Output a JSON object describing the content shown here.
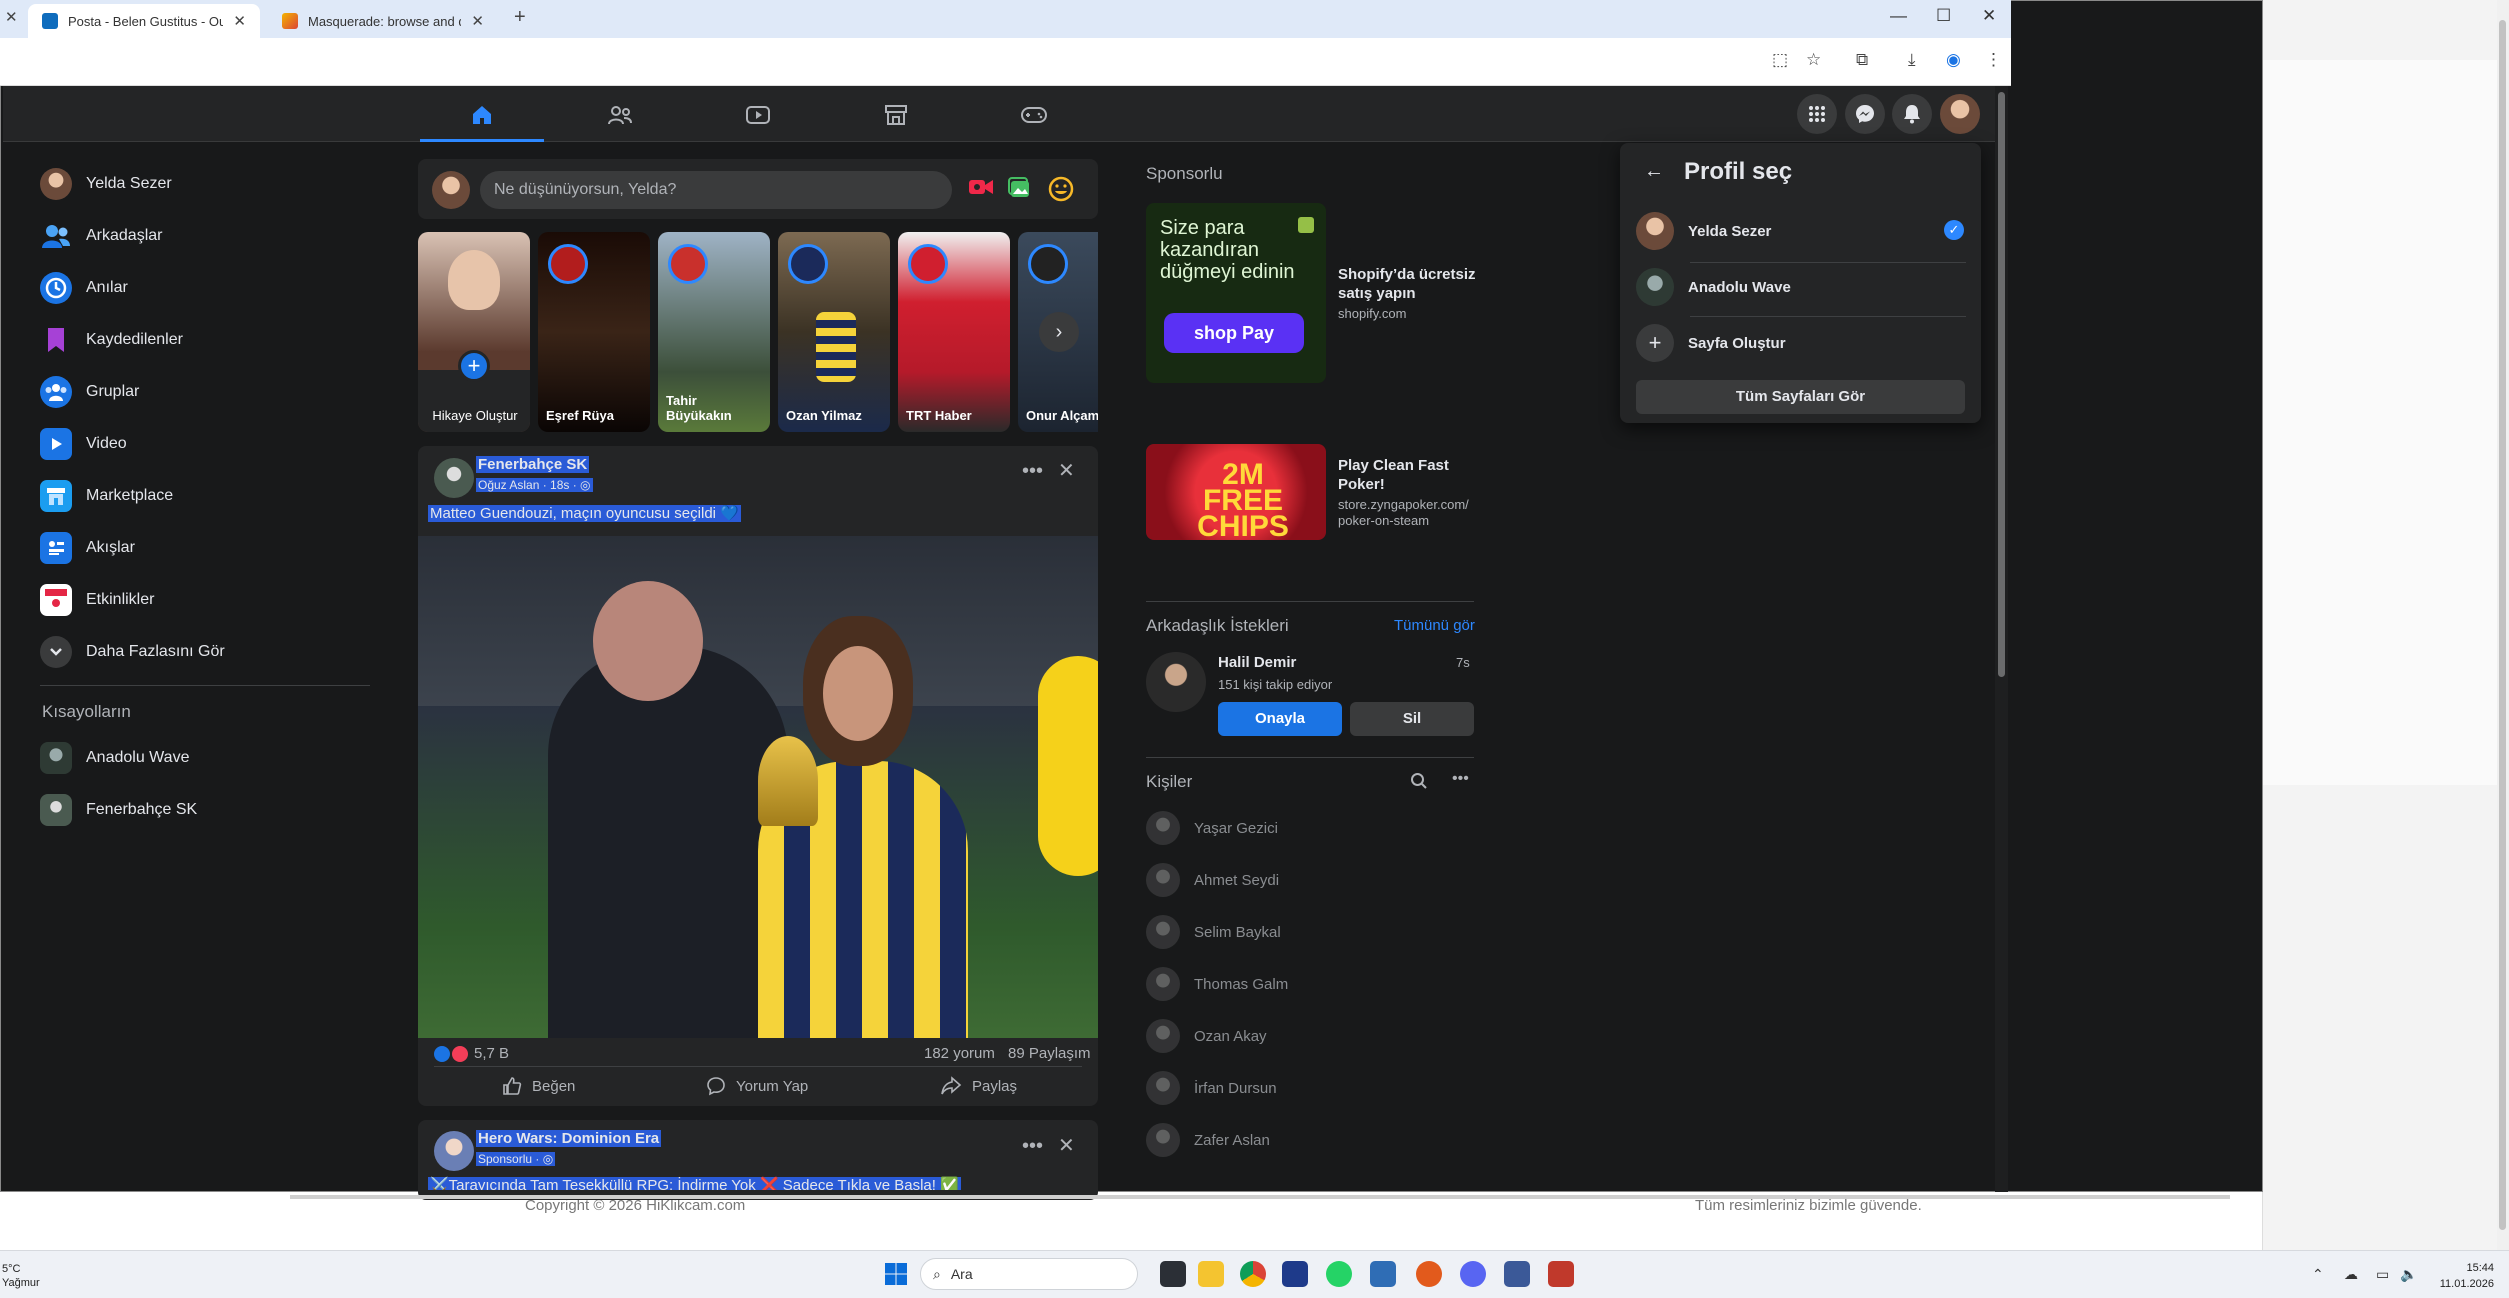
{
  "browser": {
    "tabs": [
      {
        "label": "Posta - Belen Gustitus - Outlook"
      },
      {
        "label": "Masquerade: browse and down"
      }
    ]
  },
  "nav": {
    "items": [
      "home",
      "friends",
      "video",
      "marketplace",
      "gaming"
    ]
  },
  "sidebar": {
    "items": [
      {
        "label": "Yelda Sezer"
      },
      {
        "label": "Arkadaşlar"
      },
      {
        "label": "Anılar"
      },
      {
        "label": "Kaydedilenler"
      },
      {
        "label": "Gruplar"
      },
      {
        "label": "Video"
      },
      {
        "label": "Marketplace"
      },
      {
        "label": "Akışlar"
      },
      {
        "label": "Etkinlikler"
      },
      {
        "label": "Daha Fazlasını Gör"
      }
    ],
    "shortcuts_title": "Kısayolların",
    "shortcuts": [
      {
        "label": "Anadolu Wave"
      },
      {
        "label": "Fenerbahçe SK"
      }
    ]
  },
  "composer": {
    "placeholder": "Ne düşünüyorsun, Yelda?"
  },
  "stories": [
    {
      "name": "Hikaye Oluştur"
    },
    {
      "name": "Eşref Rüya"
    },
    {
      "name": "Tahir Büyükakın"
    },
    {
      "name": "Ozan Yilmaz"
    },
    {
      "name": "TRT Haber"
    },
    {
      "name": "Onur Alçam"
    }
  ],
  "post1": {
    "page": "Fenerbahçe SK",
    "meta": "Oğuz Aslan · 18s · ◎",
    "text": "Matteo Guendouzi, maçın oyuncusu seçildi 💙",
    "reactions": "5,7 B",
    "comments": "182 yorum",
    "shares": "89 Paylaşım",
    "actions": {
      "like": "Beğen",
      "comment": "Yorum Yap",
      "share": "Paylaş"
    }
  },
  "post2": {
    "page": "Hero Wars: Dominion Era",
    "meta": "Sponsorlu · ◎",
    "text": "⚔️Tarayıcında Tam Teşekküllü RPG: İndirme Yok ❌ Sadece Tıkla ve Başla! ✅"
  },
  "right": {
    "sponsored_title": "Sponsorlu",
    "ads": [
      {
        "title": "Shopify’da ücretsiz satış yapın",
        "url": "shopify.com",
        "img_text": "Size para kazandıran düğmeyi edinin",
        "btn": "shop Pay"
      },
      {
        "title": "Play Clean Fast Poker!",
        "url": "store.zyngapoker.com/ poker-on-steam",
        "img_text": "2M FREE CHIPS"
      }
    ],
    "friend_requests": {
      "title": "Arkadaşlık İstekleri",
      "see_all": "Tümünü gör",
      "name": "Halil Demir",
      "time": "7s",
      "sub": "151 kişi takip ediyor",
      "confirm": "Onayla",
      "delete": "Sil"
    },
    "contacts_title": "Kişiler",
    "contacts": [
      "Yaşar Gezici",
      "Ahmet Seydi",
      "Selim Baykal",
      "Thomas Galm",
      "Ozan Akay",
      "İrfan Dursun",
      "Zafer Aslan"
    ]
  },
  "profile_popup": {
    "title": "Profil seç",
    "profiles": [
      {
        "name": "Yelda Sezer"
      },
      {
        "name": "Anadolu Wave"
      }
    ],
    "create_page": "Sayfa Oluştur",
    "see_all": "Tüm Sayfaları Gör"
  },
  "behind": {
    "copyright": "Copyright © 2026 HiKlikcam.com",
    "tagline": "Tüm resimleriniz bizimle güvende."
  },
  "taskbar": {
    "weather_temp": "5°C",
    "weather_desc": "Yağmur",
    "search": "Ara",
    "time": "15:44",
    "date": "11.01.2026"
  },
  "colors": {
    "fb_blue": "#1b74e4",
    "fb_bg": "#18191a",
    "fb_card": "#242526",
    "highlight": "#2a5bd7"
  }
}
